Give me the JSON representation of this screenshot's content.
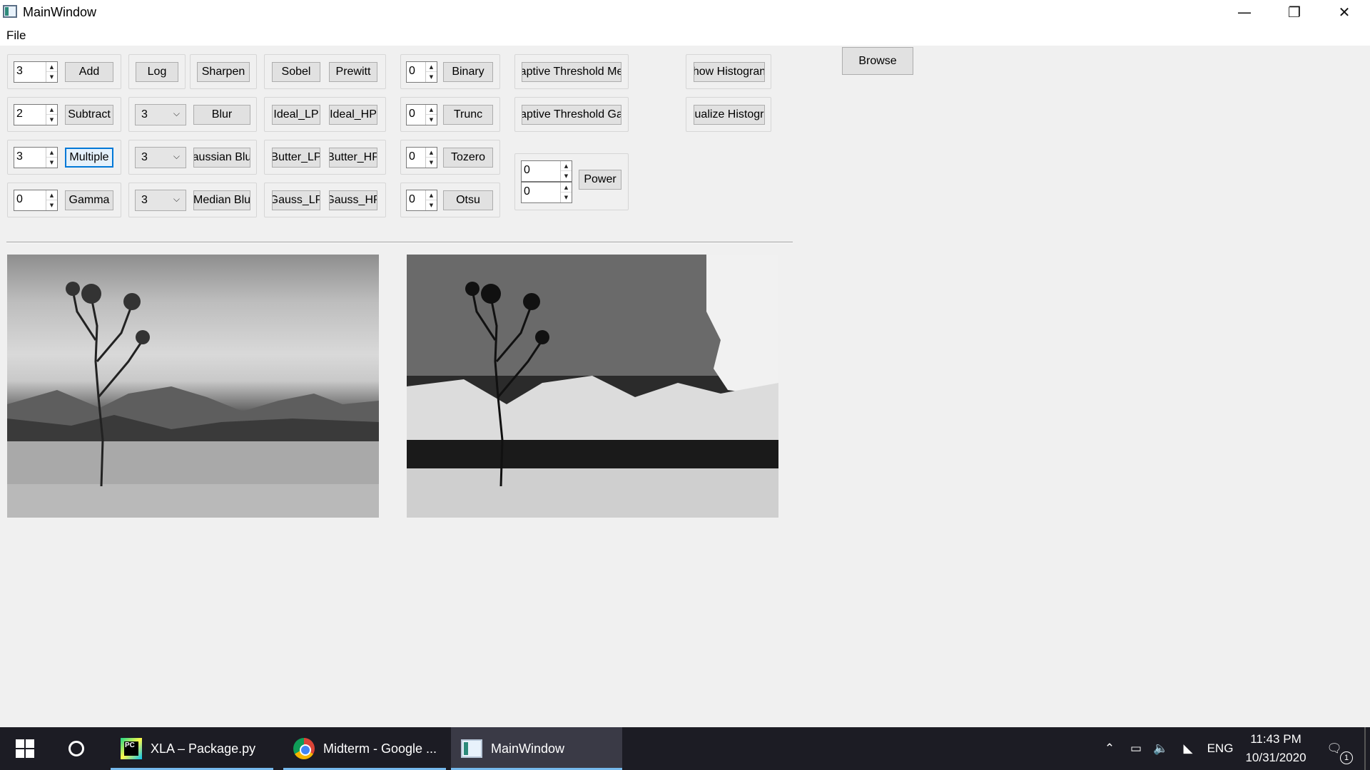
{
  "window": {
    "title": "MainWindow",
    "icons": {
      "minimize": "minimize-icon",
      "maximize": "restore-icon",
      "close": "close-icon"
    }
  },
  "menu": {
    "file": "File"
  },
  "arithmetic": {
    "rows": [
      {
        "value": "3",
        "label": "Add"
      },
      {
        "value": "2",
        "label": "Subtract"
      },
      {
        "value": "3",
        "label": "Multiple"
      },
      {
        "value": "0",
        "label": "Gamma"
      }
    ]
  },
  "filters": {
    "log": "Log",
    "sharpen": "Sharpen",
    "blur_value": "3",
    "blur": "Blur",
    "gaussian_value": "3",
    "gaussian": "aussian Blu",
    "median_value": "3",
    "median": "Median Blu"
  },
  "edges": {
    "rows": [
      [
        "Sobel",
        "Prewitt"
      ],
      [
        "Ideal_LP",
        "Ideal_HP"
      ],
      [
        "Butter_LP",
        "Butter_HP"
      ],
      [
        "Gauss_LP",
        "Gauss_HP"
      ]
    ]
  },
  "threshold": {
    "rows": [
      {
        "value": "0",
        "label": "Binary"
      },
      {
        "value": "0",
        "label": "Trunc"
      },
      {
        "value": "0",
        "label": "Tozero"
      },
      {
        "value": "0",
        "label": "Otsu"
      }
    ]
  },
  "adaptive": {
    "mean": "aptive Threshold Me",
    "gaussian": "aptive Threshold Ga",
    "power_value_1": "0",
    "power_value_2": "0",
    "power": "Power"
  },
  "histogram": {
    "show": "how Histogran",
    "equalize": "ualize Histogr"
  },
  "browse": "Browse",
  "taskbar": {
    "apps": [
      {
        "label": "XLA – Package.py",
        "icon": "pycharm-icon"
      },
      {
        "label": "Midterm - Google ...",
        "icon": "chrome-icon"
      },
      {
        "label": "MainWindow",
        "icon": "mainwindow-icon"
      }
    ],
    "language": "ENG",
    "time": "11:43 PM",
    "date": "10/31/2020",
    "notifications": "1"
  }
}
